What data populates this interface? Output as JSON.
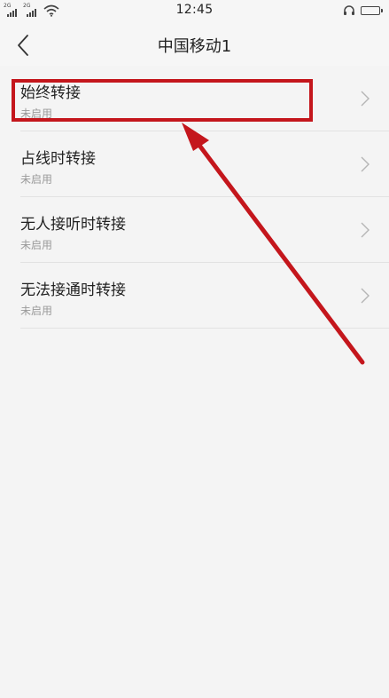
{
  "status_bar": {
    "time": "12:45",
    "sim1_tag": "2G",
    "sim2_tag": "2G"
  },
  "header": {
    "title": "中国移动1"
  },
  "forwarding_options": [
    {
      "label": "始终转接",
      "status": "未启用"
    },
    {
      "label": "占线时转接",
      "status": "未启用"
    },
    {
      "label": "无人接听时转接",
      "status": "未启用"
    },
    {
      "label": "无法接通时转接",
      "status": "未启用"
    }
  ],
  "annotation": {
    "color": "#c4161c",
    "highlighted_item": "始终转接"
  },
  "icons": [
    "signal-icon",
    "wifi-icon",
    "headset-icon",
    "battery-icon",
    "back-arrow-icon",
    "chevron-right-icon"
  ]
}
